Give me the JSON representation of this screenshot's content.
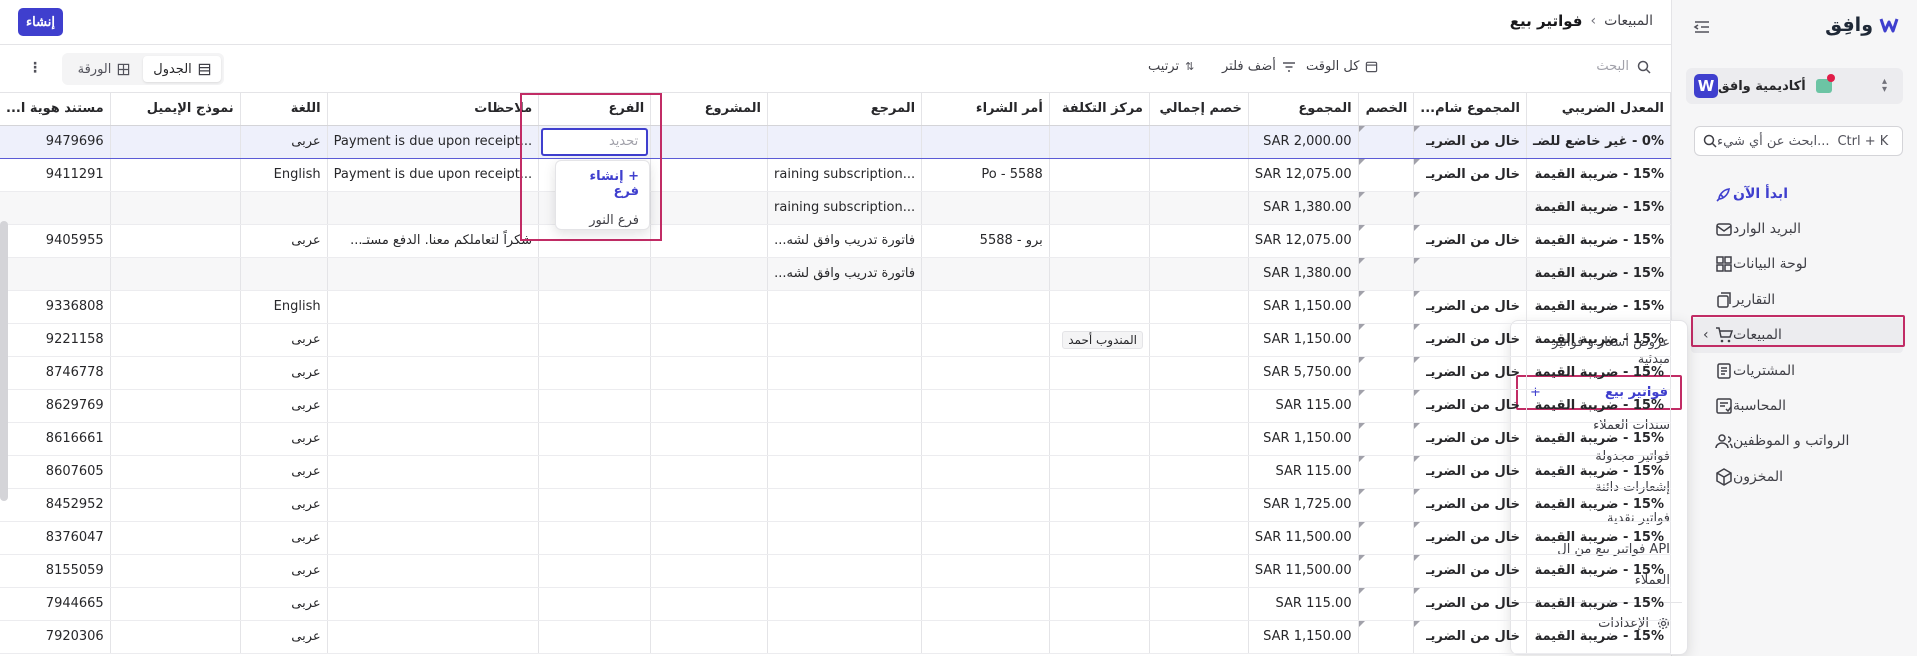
{
  "app": {
    "logo": "وافِق",
    "org_name": "أكاديمية وافق",
    "search_placeholder": "ابحث عن أي شيء...",
    "search_shortcut": "Ctrl + K"
  },
  "nav": [
    {
      "label": "ابدأ الآن",
      "icon": "rocket-icon"
    },
    {
      "label": "البريد الوارد",
      "icon": "inbox-icon"
    },
    {
      "label": "لوحة البيانات",
      "icon": "dashboard-icon"
    },
    {
      "label": "التقارير",
      "icon": "reports-icon"
    },
    {
      "label": "المبيعات",
      "icon": "cart-icon"
    },
    {
      "label": "المشتريات",
      "icon": "purchases-icon"
    },
    {
      "label": "المحاسبة",
      "icon": "accounting-icon"
    },
    {
      "label": "الرواتب و الموظفين",
      "icon": "employees-icon"
    },
    {
      "label": "المخزون",
      "icon": "inventory-icon"
    }
  ],
  "submenu": {
    "items": [
      "عروض أسعار و فواتير مبدئية",
      "فواتير بيع",
      "سندات العملاء",
      "فواتير مجدولة",
      "إشعارات دائنة",
      "فواتير نقدية",
      "فواتير بيع من ال API",
      "العملاء"
    ],
    "plus": "+",
    "settings": "الإعدادات"
  },
  "header": {
    "create": "إنشاء",
    "crumb_parent": "المبيعات",
    "crumb_current": "فواتير بيع",
    "crumb_sep": "›"
  },
  "toolbar": {
    "search": "البحث",
    "time": "كل الوقت",
    "filter": "أضف فلتر",
    "sort": "ترتيب",
    "table_view": "الجدول",
    "sheet_view": "الورقة",
    "more": "⋮"
  },
  "table": {
    "columns": [
      "المعدل الضريبي",
      "المجموع شام...",
      "الخصم",
      "المجموع",
      "خصم إجمالي",
      "مركز التكلفة",
      "أمر الشراء",
      "المرجع",
      "المشروع",
      "الفرع",
      "ملاحظات",
      "اللغة",
      "نموذج الإيميل",
      "مستند هوية ا..."
    ],
    "rows": [
      [
        "0% - غير خاضع للضـ",
        "خال من الضريـ",
        "",
        "SAR 2,000.00",
        "",
        "",
        "",
        "",
        "",
        "",
        "Payment is due upon receipt...",
        "عربى",
        "",
        "9479696"
      ],
      [
        "15% - ضريبة القيمة",
        "خال من الضريـ",
        "",
        "SAR 12,075.00",
        "",
        "",
        "Po - 5588",
        "raining subscription...",
        "",
        "",
        "Payment is due upon receipt...",
        "English",
        "",
        "9411291"
      ],
      [
        "15% - ضريبة القيمة",
        "",
        "",
        "SAR 1,380.00",
        "",
        "",
        "",
        "raining subscription...",
        "",
        "",
        "",
        "",
        "",
        ""
      ],
      [
        "15% - ضريبة القيمة",
        "خال من الضريـ",
        "",
        "SAR 12,075.00",
        "",
        "",
        "برو - 5588",
        "فاتورة تدريب وافق لشه...",
        "",
        "",
        "شكراً لتعاملكم معنا. الدفع مستـ...",
        "عربى",
        "",
        "9405955"
      ],
      [
        "15% - ضريبة القيمة",
        "",
        "",
        "SAR 1,380.00",
        "",
        "",
        "",
        "فاتورة تدريب وافق لشه...",
        "",
        "",
        "",
        "",
        "",
        ""
      ],
      [
        "15% - ضريبة القيمة",
        "خال من الضريـ",
        "",
        "SAR 1,150.00",
        "",
        "",
        "",
        "",
        "",
        "",
        "",
        "English",
        "",
        "9336808"
      ],
      [
        "15% - ضريبة القيمة",
        "خال من الضريـ",
        "",
        "SAR 1,150.00",
        "",
        "المندوب أحمد",
        "",
        "",
        "",
        "",
        "",
        "عربى",
        "",
        "9221158"
      ],
      [
        "15% - ضريبة القيمة",
        "خال من الضريـ",
        "",
        "SAR 5,750.00",
        "",
        "",
        "",
        "",
        "",
        "",
        "",
        "عربى",
        "",
        "8746778"
      ],
      [
        "15% - ضريبة القيمة",
        "خال من الضريـ",
        "",
        "SAR 115.00",
        "",
        "",
        "",
        "",
        "",
        "",
        "",
        "عربى",
        "",
        "8629769"
      ],
      [
        "15% - ضريبة القيمة",
        "خال من الضريـ",
        "",
        "SAR 1,150.00",
        "",
        "",
        "",
        "",
        "",
        "",
        "",
        "عربى",
        "",
        "8616661"
      ],
      [
        "15% - ضريبة القيمة",
        "خال من الضريـ",
        "",
        "SAR 115.00",
        "",
        "",
        "",
        "",
        "",
        "",
        "",
        "عربى",
        "",
        "8607605"
      ],
      [
        "15% - ضريبة القيمة",
        "خال من الضريـ",
        "",
        "SAR 1,725.00",
        "",
        "",
        "",
        "",
        "",
        "",
        "",
        "عربى",
        "",
        "8452952"
      ],
      [
        "15% - ضريبة القيمة",
        "خال من الضريـ",
        "",
        "SAR 11,500.00",
        "",
        "",
        "",
        "",
        "",
        "",
        "",
        "عربى",
        "",
        "8376047"
      ],
      [
        "15% - ضريبة القيمة",
        "خال من الضريـ",
        "",
        "SAR 11,500.00",
        "",
        "",
        "",
        "",
        "",
        "",
        "",
        "عربى",
        "",
        "8155059"
      ],
      [
        "15% - ضريبة القيمة",
        "خال من الضريـ",
        "",
        "SAR 115.00",
        "",
        "",
        "",
        "",
        "",
        "",
        "",
        "عربى",
        "",
        "7944665"
      ],
      [
        "15% - ضريبة القيمة",
        "خال من الضريـ",
        "",
        "SAR 1,150.00",
        "",
        "",
        "",
        "",
        "",
        "",
        "",
        "عربى",
        "",
        "7920306"
      ]
    ]
  },
  "branch_editor": {
    "placeholder": "تحديد",
    "create": "+ إنشاء فرع",
    "option": "فرع النور"
  }
}
